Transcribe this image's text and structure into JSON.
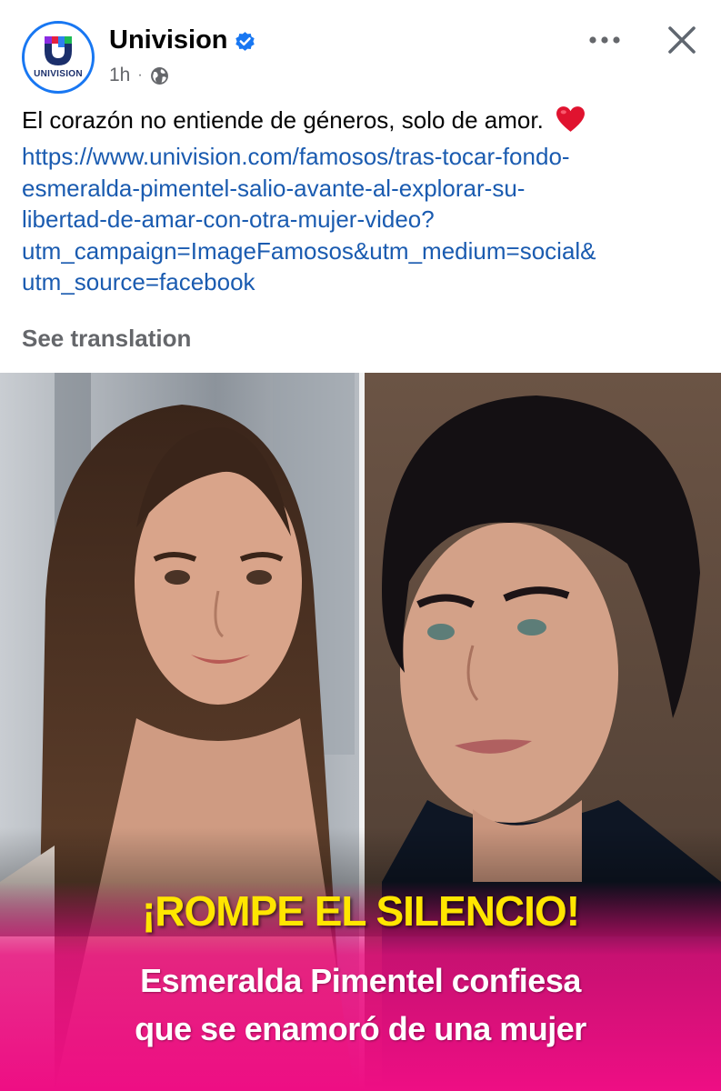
{
  "post": {
    "page_name": "Univision",
    "avatar_text": "UNIVISION",
    "time": "1h",
    "separator": "·",
    "privacy_icon": "globe-icon",
    "verified_icon": "verified-badge-icon",
    "more_icon": "more-options-icon",
    "close_icon": "close-icon",
    "caption": "El corazón no entiende de géneros, solo de amor.",
    "caption_emoji": "heart-emoji-icon",
    "link_text": "https://www.univision.com/famosos/tras-tocar-fondo-\nesmeralda-pimentel-salio-avante-al-explorar-su-\nlibertad-de-amar-con-otra-mujer-video?\nutm_campaign=ImageFamosos&utm_medium=social&\nutm_source=facebook",
    "see_translation": "See translation"
  },
  "image": {
    "headline": "¡ROMPE EL SILENCIO!",
    "subline_1": "Esmeralda Pimentel confiesa",
    "subline_2": "que se enamoró de una mujer"
  },
  "colors": {
    "accent": "#1877f2",
    "link": "#1a5bb0",
    "secondary_text": "#65676b",
    "banner_magenta": "#e8107f",
    "headline_yellow": "#ffe600"
  }
}
